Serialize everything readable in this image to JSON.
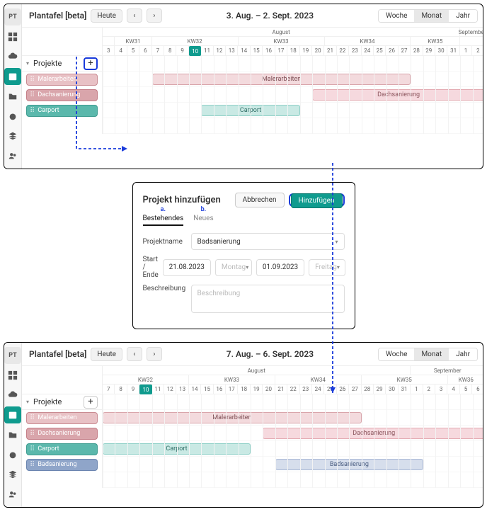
{
  "sidebar": {
    "logo": "PT"
  },
  "panel1": {
    "title": "Plantafel [beta]",
    "today": "Heute",
    "prev": "‹",
    "next": "›",
    "range": "3. Aug. – 2. Sept. 2023",
    "views": {
      "week": "Woche",
      "month": "Monat",
      "year": "Jahr"
    },
    "months": [
      {
        "label": "August",
        "span": 29
      },
      {
        "label": "September",
        "span": 2
      }
    ],
    "weeks": [
      {
        "label": "",
        "span": 1
      },
      {
        "label": "KW31",
        "span": 3
      },
      {
        "label": "KW32",
        "span": 7
      },
      {
        "label": "KW33",
        "span": 7
      },
      {
        "label": "KW34",
        "span": 7
      },
      {
        "label": "KW35",
        "span": 4
      },
      {
        "label": "",
        "span": 2
      }
    ],
    "days": [
      "3",
      "4",
      "5",
      "6",
      "7",
      "8",
      "9",
      "10",
      "11",
      "12",
      "13",
      "14",
      "15",
      "16",
      "17",
      "18",
      "19",
      "20",
      "21",
      "22",
      "23",
      "24",
      "25",
      "26",
      "27",
      "28",
      "29",
      "30",
      "31",
      "1",
      "2"
    ],
    "today_idx": 7,
    "projects_label": "Projekte",
    "rows": [
      {
        "name": "Malerarbeiten",
        "color_bg": "#e8c1c5",
        "color_border": "#c98b92",
        "bar": {
          "start": 5,
          "end": 25,
          "label": "Malerarbeiten",
          "bg": "#f3dadd",
          "bc": "#d9a5ab",
          "fg": "#7a4a50"
        }
      },
      {
        "name": "Dachsanierung",
        "color_bg": "#d9a5ab",
        "color_border": "#c47e87",
        "bar": {
          "start": 18,
          "end": 31,
          "label": "Dachsanierung",
          "bg": "#f6d9de",
          "bc": "#e3aab2",
          "fg": "#8a545c",
          "arrow": true
        }
      },
      {
        "name": "Carport",
        "color_bg": "#5bb8ac",
        "color_border": "#3e9c90",
        "bar": {
          "start": 9,
          "end": 16,
          "label": "Carport",
          "bg": "#c9e9e4",
          "bc": "#8fd0c7",
          "fg": "#2f6e66"
        }
      }
    ]
  },
  "dialog": {
    "title": "Projekt hinzufügen",
    "cancel": "Abbrechen",
    "submit": "Hinzufügen",
    "tabs": {
      "existing": "Bestehendes",
      "new": "Neues",
      "a": "a.",
      "b": "b."
    },
    "fields": {
      "name_label": "Projektname",
      "name_value": "Badsanierung",
      "dates_label": "Start / Ende",
      "start": "21.08.2023",
      "start_dow": "Montag",
      "end": "01.09.2023",
      "end_dow": "Freitag",
      "desc_label": "Beschreibung",
      "desc_placeholder": "Beschreibung"
    }
  },
  "panel2": {
    "title": "Plantafel [beta]",
    "today": "Heute",
    "prev": "‹",
    "next": "›",
    "range": "7. Aug. – 6. Sept. 2023",
    "views": {
      "week": "Woche",
      "month": "Monat",
      "year": "Jahr"
    },
    "months": [
      {
        "label": "August",
        "span": 25
      },
      {
        "label": "September",
        "span": 6
      }
    ],
    "weeks": [
      {
        "label": "KW32",
        "span": 7
      },
      {
        "label": "KW33",
        "span": 7
      },
      {
        "label": "KW34",
        "span": 7
      },
      {
        "label": "KW35",
        "span": 7
      },
      {
        "label": "KW36",
        "span": 3
      }
    ],
    "days": [
      "7",
      "8",
      "9",
      "10",
      "11",
      "12",
      "13",
      "14",
      "15",
      "16",
      "17",
      "18",
      "19",
      "20",
      "21",
      "22",
      "23",
      "24",
      "25",
      "26",
      "27",
      "28",
      "29",
      "30",
      "31",
      "1",
      "2",
      "3",
      "4",
      "5",
      "6"
    ],
    "today_idx": 3,
    "projects_label": "Projekte",
    "rows": [
      {
        "name": "Malerarbeiten",
        "color_bg": "#e8c1c5",
        "color_border": "#c98b92",
        "bar": {
          "start": 1,
          "end": 21,
          "label": "Malerarbeiten",
          "bg": "#f3dadd",
          "bc": "#d9a5ab",
          "fg": "#7a4a50"
        }
      },
      {
        "name": "Dachsanierung",
        "color_bg": "#d9a5ab",
        "color_border": "#c47e87",
        "bar": {
          "start": 14,
          "end": 31,
          "label": "Dachsanierung",
          "bg": "#f6d9de",
          "bc": "#e3aab2",
          "fg": "#8a545c",
          "arrow": true
        }
      },
      {
        "name": "Carport",
        "color_bg": "#5bb8ac",
        "color_border": "#3e9c90",
        "bar": {
          "start": 1,
          "end": 12,
          "label": "Carport",
          "bg": "#c9e9e4",
          "bc": "#8fd0c7",
          "fg": "#2f6e66"
        }
      },
      {
        "name": "Badsanierung",
        "color_bg": "#8fa5c9",
        "color_border": "#6b85b0",
        "bar": {
          "start": 15,
          "end": 26,
          "label": "Badsanierung",
          "bg": "#d6deec",
          "bc": "#aab9d6",
          "fg": "#4a5d80"
        }
      }
    ]
  }
}
